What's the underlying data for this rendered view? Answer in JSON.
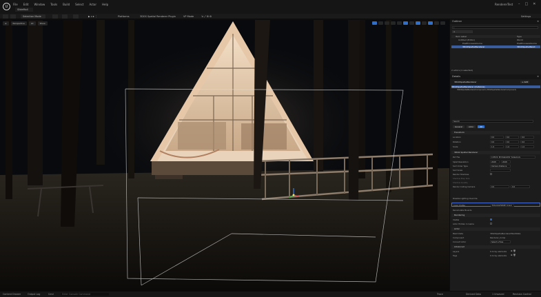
{
  "window": {
    "menu": [
      "File",
      "Edit",
      "Window",
      "Tools",
      "Build",
      "Select",
      "Actor",
      "Help"
    ],
    "map_tab": "SlideMoll",
    "project_name": "RendererTest",
    "controls": [
      "–",
      "□",
      "✕"
    ]
  },
  "toolbar": {
    "mode_label": "Selection Mode",
    "platforms_label": "Platforms",
    "plugin_label": "3DGS Spatial Renderer Plugin",
    "vp_label": "VP Mode",
    "settings_label": "Settings"
  },
  "viewport": {
    "perspective_label": "Perspective",
    "lit_label": "Lit",
    "show_label": "Show"
  },
  "outliner": {
    "title": "Outliner",
    "col_item": "Item Label",
    "col_type": "Type",
    "items": [
      {
        "label": "Untitled (Editor)",
        "type": "World"
      },
      {
        "label": "PostProcessVolume",
        "type": "PostProcessVolume"
      },
      {
        "label": "3DGSSpatialRenderer",
        "type": "3DGSSpatialRend"
      }
    ],
    "footer": "2 actors (1 selected)"
  },
  "details": {
    "title": "Details",
    "actor_name": "3DGSSpatialRenderer",
    "add_label": "+ Add",
    "root_component": "3DGSSpatialRenderer (Instance)",
    "child_component": "3DGSSpatialRendererComponent (3DGSSpatialRendererComponent)",
    "search_placeholder": "Search",
    "tabs": [
      "General",
      "Actor",
      "All"
    ],
    "sections": {
      "transform": "Transform",
      "spatial": "3DGS Spatial Renderer",
      "rendering": "Rendering",
      "actor": "Actor",
      "advanced": "Advanced"
    },
    "transform": {
      "location_label": "Location",
      "rotation_label": "Rotation",
      "scale_label": "Scale",
      "location": [
        "0.0",
        "0.0",
        "0.0"
      ],
      "rotation": [
        "0.0",
        "0.0",
        "0.0"
      ],
      "scale": [
        "1.0",
        "1.0",
        "1.0"
      ]
    },
    "spatial": {
      "ply_file_label": "PLY File",
      "ply_file_value": "C:/PLY2_PLY/CabinPLY_Scaled.ply",
      "splat_resolution_label": "Splat Resolution",
      "splat_resolution_values": [
        "2048",
        "2048"
      ],
      "sort_mode_label": "Sort Order Type",
      "sort_mode_value": "Camera Distance",
      "sort_scale_label": "Sort Scale",
      "shadow_label": "Render Shadows",
      "shadow_size_label": "Shadow Map Size",
      "shadow_quality_label": "Shadow Quality",
      "culling_label": "Render Culling Camera",
      "culling_values": [
        "0.0",
        "0.0"
      ],
      "lighting_label": "Disable Lighting Override",
      "color_profile_label": "Color Profile",
      "color_profile_value": "ExtendedSRGB_Linear",
      "bounds_label": "Recalculate Bounds"
    },
    "rendering": {
      "visible_label": "Visible",
      "hidden_label": "Actor Hidden In Game"
    },
    "actor": {
      "mesh_label": "Mesh Data",
      "mesh_value": "3DGSSpatialRendererMeshData",
      "component_label": "Component",
      "component_value": "Renderer_Comp",
      "convert_label": "Convert Actor",
      "convert_value": "Select a Type",
      "layers_label": "Layers",
      "layers_value": "0 Array elements",
      "tags_label": "Tags",
      "tags_value": "0 Array elements"
    }
  },
  "status": {
    "content_drawer": "Content Drawer",
    "output_log": "Output Log",
    "cmd": "Cmd",
    "cmd_placeholder": "Enter Console Command",
    "trace": "Trace",
    "derived": "Derived Data",
    "unsaved": "1 Unsaved",
    "revision": "Revision Control"
  },
  "colors": {
    "accent_blue": "#2f6fc9",
    "selection_highlight": "#3a5d9e",
    "play_green": "#4fbf4f",
    "panel_bg": "#1c1c1c"
  }
}
